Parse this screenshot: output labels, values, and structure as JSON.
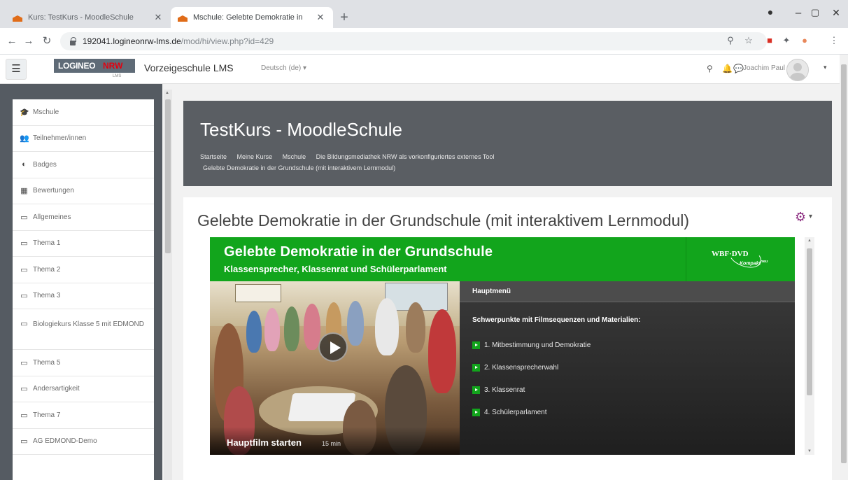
{
  "browser": {
    "tabs": [
      {
        "label": "Kurs: TestKurs - MoodleSchule",
        "active": false
      },
      {
        "label": "Mschule: Gelebte Demokratie in",
        "active": true
      }
    ],
    "new_tab": "+",
    "window_controls": {
      "minimize": "–",
      "maximize": "▢",
      "close": "✕"
    },
    "url_host": "192041.logineonrw-lms.de",
    "url_path": "/mod/hi/view.php?id=429"
  },
  "navbar": {
    "menu_icon": "☰",
    "logo_left": "LOGINEO",
    "logo_right_prefix": "NRW",
    "logo_small": "LMS",
    "site_name": "Vorzeigeschule LMS",
    "language": "Deutsch (de) ▾",
    "user_name": "Joachim Paul",
    "user_menu_caret": "▾"
  },
  "sidebar": {
    "items": [
      {
        "icon": "graduation-cap-icon",
        "glyph": "🎓",
        "label": "Mschule"
      },
      {
        "icon": "users-icon",
        "glyph": "👥",
        "label": "Teilnehmer/innen"
      },
      {
        "icon": "shield-icon",
        "glyph": "◐",
        "label": "Badges"
      },
      {
        "icon": "table-icon",
        "glyph": "▦",
        "label": "Bewertungen"
      },
      {
        "icon": "folder-icon",
        "glyph": "▭",
        "label": "Allgemeines"
      },
      {
        "icon": "folder-icon",
        "glyph": "▭",
        "label": "Thema 1"
      },
      {
        "icon": "folder-icon",
        "glyph": "▭",
        "label": "Thema 2"
      },
      {
        "icon": "folder-icon",
        "glyph": "▭",
        "label": "Thema 3"
      },
      {
        "icon": "folder-icon",
        "glyph": "▭",
        "label": "Biologiekurs Klasse 5 mit EDMOND"
      },
      {
        "icon": "folder-icon",
        "glyph": "▭",
        "label": "Thema 5"
      },
      {
        "icon": "folder-icon",
        "glyph": "▭",
        "label": "Andersartigkeit"
      },
      {
        "icon": "folder-icon",
        "glyph": "▭",
        "label": "Thema 7"
      },
      {
        "icon": "folder-icon",
        "glyph": "▭",
        "label": "AG EDMOND-Demo"
      }
    ]
  },
  "header": {
    "course_title": "TestKurs - MoodleSchule",
    "breadcrumb_line1": [
      "Startseite",
      "Meine Kurse",
      "Mschule",
      "Die Bildungsmediathek NRW als vorkonfiguriertes externes Tool"
    ],
    "breadcrumb_line2": "Gelebte Demokratie in der Grundschule (mit interaktivem Lernmodul)"
  },
  "content": {
    "page_heading": "Gelebte Demokratie in der Grundschule (mit interaktivem Lernmodul)",
    "settings_caret": "▾"
  },
  "module": {
    "title": "Gelebte Demokratie in der Grundschule",
    "subtitle": "Klassensprecher, Klassenrat und Schülerparlament",
    "brand": "WBF·DVD",
    "brand_sub": "Kompakt",
    "brand_sup": "neu",
    "video_caption": "Hauptfilm starten",
    "video_duration": "15 min",
    "menu_header": "Hauptmenü",
    "menu_subtitle": "Schwerpunkte mit Filmsequenzen und Materialien:",
    "menu_items": [
      "1. Mitbestimmung und Demokratie",
      "2. Klassensprecherwahl",
      "3. Klassenrat",
      "4. Schülerparlament"
    ],
    "accent_color": "#12a51c"
  }
}
